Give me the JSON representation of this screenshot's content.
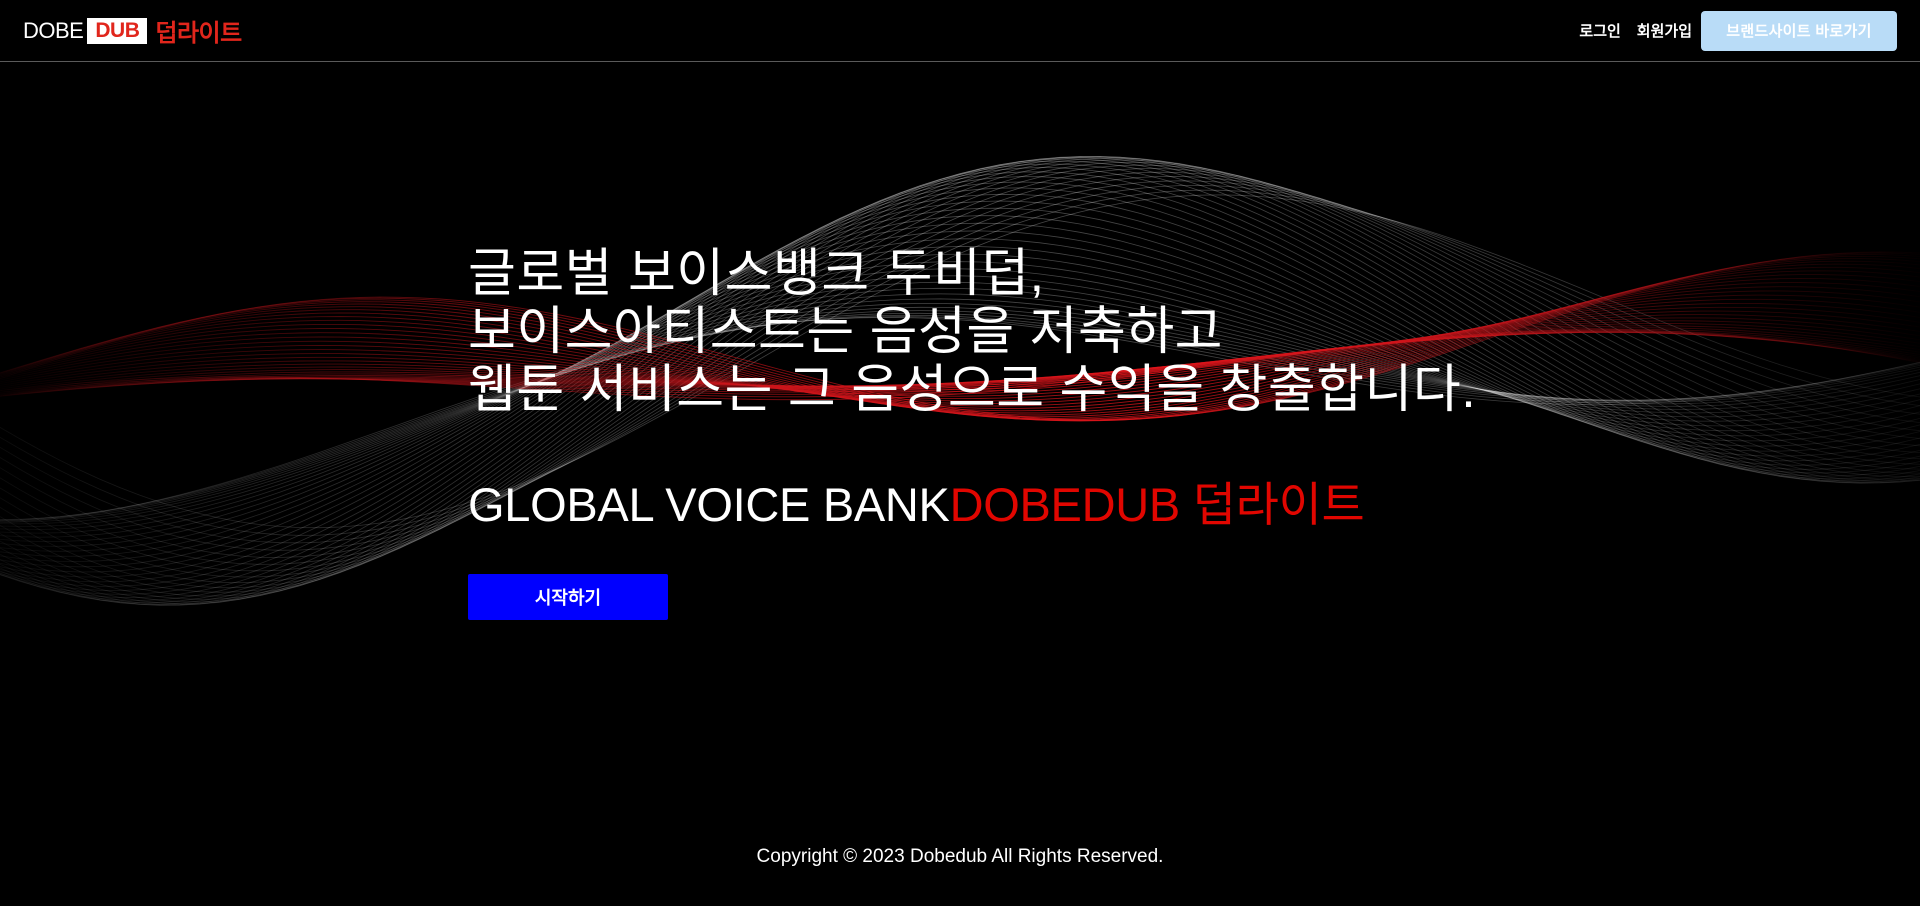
{
  "header": {
    "logo": {
      "part1": "DOBE",
      "part2": "DUB",
      "part3": "덥라이트"
    },
    "nav": {
      "login": "로그인",
      "signup": "회원가입",
      "brand_site": "브랜드사이트 바로가기"
    }
  },
  "hero": {
    "lines": [
      "글로벌 보이스뱅크 두비덥,",
      "보이스아티스트는 음성을 저축하고",
      "웹툰 서비스는 그 음성으로 수익을 창출합니다."
    ],
    "subtitle_en": "GLOBAL VOICE BANK",
    "subtitle_brand": "DOBEDUB 덥라이트",
    "start_button": "시작하기"
  },
  "footer": {
    "copyright": "Copyright © 2023 Dobedub All Rights Reserved."
  },
  "colors": {
    "background": "#000000",
    "brand_red": "#e10600",
    "start_button": "#0000ff",
    "brand_site_button": "#b9dcf7",
    "wave_grey": "#9a9a9a",
    "wave_red": "#c0141a"
  }
}
